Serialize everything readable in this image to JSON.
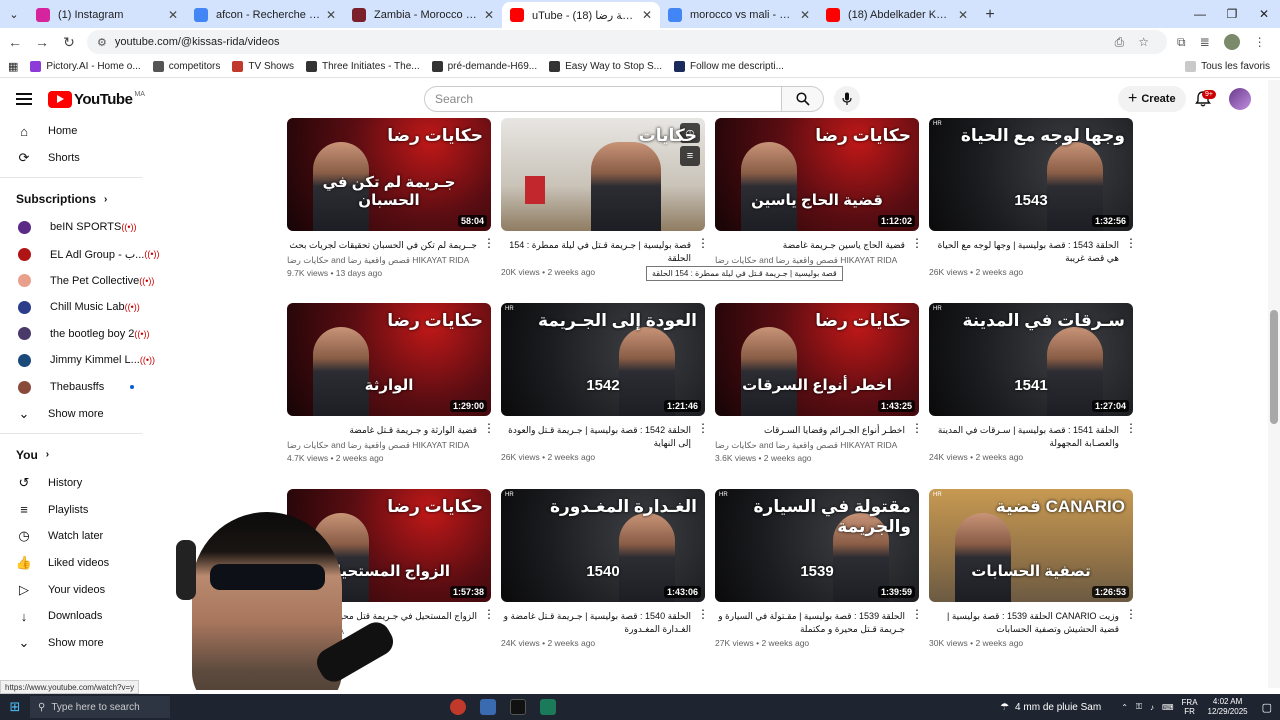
{
  "browser": {
    "tabs": [
      {
        "title": "(1) Instagram",
        "color": "#d6249f",
        "active": false
      },
      {
        "title": "afcon - Recherche Google",
        "color": "#4285f4",
        "active": false
      },
      {
        "title": "Zambia - Morocco Betting - 29",
        "color": "#7a1f2b",
        "active": false
      },
      {
        "title": "uTube - (18) قصص واقعية رضا",
        "color": "#ff0000",
        "active": true
      },
      {
        "title": "morocco vs mali - Recherche G",
        "color": "#4285f4",
        "active": false
      },
      {
        "title": "(18) Abdelkader Kharraz - YouT",
        "color": "#ff0000",
        "active": false
      }
    ],
    "url": "youtube.com/@kissas-rida/videos",
    "bookmarks": [
      {
        "label": "Pictory.AI - Home o...",
        "color": "#8c3bd9"
      },
      {
        "label": "competitors",
        "color": "#555555"
      },
      {
        "label": "TV Shows",
        "color": "#c0392b"
      },
      {
        "label": "Three Initiates - The...",
        "color": "#333333"
      },
      {
        "label": "pré-demande-H69...",
        "color": "#333333"
      },
      {
        "label": "Easy Way to Stop S...",
        "color": "#333333"
      },
      {
        "label": "Follow me descripti...",
        "color": "#1a2a5a"
      }
    ],
    "all_bookmarks": "Tous les favoris",
    "status_url": "https://www.youtube.com/watch?v=y"
  },
  "yt": {
    "logo_text": "YouTube",
    "country": "MA",
    "search_placeholder": "Search",
    "create_label": "Create",
    "notif_badge": "9+",
    "tooltip": "قصة بوليسية | جـريمة قـتل في ليلة ممطرة : 154 الحلقة"
  },
  "sidebar": {
    "main": [
      {
        "label": "Home",
        "icon": "home-icon",
        "glyph": "⌂"
      },
      {
        "label": "Shorts",
        "icon": "shorts-icon",
        "glyph": "⟳"
      }
    ],
    "subs_title": "Subscriptions",
    "subs": [
      {
        "label": "beIN SPORTS",
        "color": "#5b2a86",
        "live": true
      },
      {
        "label": "EL Adl Group - ب...",
        "color": "#b01515",
        "live": true
      },
      {
        "label": "The Pet Collective",
        "color": "#e8a08a",
        "live": true
      },
      {
        "label": "Chill Music Lab",
        "color": "#2a3c8a",
        "live": true
      },
      {
        "label": "the bootleg boy 2",
        "color": "#4a3a6a",
        "live": true
      },
      {
        "label": "Jimmy Kimmel L...",
        "color": "#1a4a7a",
        "live": true
      },
      {
        "label": "Thebausffs",
        "color": "#8a4a3a",
        "live": false
      }
    ],
    "show_more": "Show more",
    "you_title": "You",
    "you": [
      {
        "label": "History",
        "icon": "history-icon",
        "glyph": "↺"
      },
      {
        "label": "Playlists",
        "icon": "playlists-icon",
        "glyph": "≡"
      },
      {
        "label": "Watch later",
        "icon": "watch-later-icon",
        "glyph": "◷"
      },
      {
        "label": "Liked videos",
        "icon": "like-icon",
        "glyph": "👍"
      },
      {
        "label": "Your videos",
        "icon": "your-videos-icon",
        "glyph": "▷"
      },
      {
        "label": "Downloads",
        "icon": "downloads-icon",
        "glyph": "↓"
      }
    ],
    "show_more2": "Show more"
  },
  "videos": [
    {
      "title": "جــريمة لم تكن في الحسبان تحقيقات لجريات بحث",
      "thumb_top": "حكايات رضا",
      "thumb_bottom": "جـريمة لم تكن في الحسبان",
      "channel": "حكايات رضا and قصص واقعية رضا HIKAYAT RIDA",
      "stats": "9.7K views • 13 days ago",
      "duration": "58:04",
      "bg": "A"
    },
    {
      "title": "قصة بوليسية | جـريمة قـتل في ليلة ممطرة : 154 الحلقة",
      "thumb_top": "حكايات",
      "thumb_bottom": "",
      "channel": "",
      "stats": "20K views • 2 weeks ago",
      "duration": "",
      "bg": "C"
    },
    {
      "title": "قضية الحاج ياسين جـريمة غامضة",
      "thumb_top": "حكايات رضا",
      "thumb_bottom": "قضية الحاج ياسين",
      "channel": "حكايات رضا and قصص واقعية رضا HIKAYAT RIDA",
      "stats": "",
      "duration": "1:12:02",
      "bg": "A"
    },
    {
      "title": "الحلقة 1543 : قصة بوليسية | وجها لوجه مع الحياة هي قصة غريبة",
      "thumb_top": "وجها لوجه مع الحياة",
      "thumb_bottom": "1543",
      "channel": "",
      "stats": "26K views • 2 weeks ago",
      "duration": "1:32:56",
      "bg": "B"
    },
    {
      "title": "قضية الوارثة و جـريمة قـتل غامضة",
      "thumb_top": "حكايات رضا",
      "thumb_bottom": "الوارثة",
      "channel": "حكايات رضا and قصص واقعية رضا HIKAYAT RIDA",
      "stats": "4.7K views • 2 weeks ago",
      "duration": "1:29:00",
      "bg": "A"
    },
    {
      "title": "الحلقة 1542 : قصة بوليسية | جـريمة قـتل والعودة إلى النهاية",
      "thumb_top": "العودة إلى الجـريمة",
      "thumb_bottom": "1542",
      "channel": "",
      "stats": "26K views • 2 weeks ago",
      "duration": "1:21:46",
      "bg": "B"
    },
    {
      "title": "اخطـر أنواع الجـرائم وقضايا السـرقات",
      "thumb_top": "حكايات رضا",
      "thumb_bottom": "اخطر أنواع السرقات",
      "channel": "حكايات رضا and قصص واقعية رضا HIKAYAT RIDA",
      "stats": "3.6K views • 2 weeks ago",
      "duration": "1:43:25",
      "bg": "A"
    },
    {
      "title": "الحلقة 1541 : قصة بوليسية | سـرقات في المدينة والعصـابة المجهولة",
      "thumb_top": "سـرقات في المدينة",
      "thumb_bottom": "1541",
      "channel": "",
      "stats": "24K views • 2 weeks ago",
      "duration": "1:27:04",
      "bg": "B"
    },
    {
      "title": "الزواج المستحيل في جـريمة قتل محيرة",
      "thumb_top": "حكايات رضا",
      "thumb_bottom": "الزواج المستحيل",
      "channel": "HIKAYAT RIDA",
      "stats": "",
      "duration": "1:57:38",
      "bg": "A"
    },
    {
      "title": "الحلقة 1540 : قصة بوليسية | جـريمة قـتل غامضة و الغـدارة المغـدورة",
      "thumb_top": "الغـدارة المغـدورة",
      "thumb_bottom": "1540",
      "channel": "",
      "stats": "24K views • 2 weeks ago",
      "duration": "1:43:06",
      "bg": "B"
    },
    {
      "title": "الحلقة 1539 : قصة بوليسية | مقـتولة في السيارة و جـريمة قـتل محيرة و مكتملة",
      "thumb_top": "مقتولة في السيارة والجريمة",
      "thumb_bottom": "1539",
      "channel": "",
      "stats": "27K views • 2 weeks ago",
      "duration": "1:39:59",
      "bg": "B"
    },
    {
      "title": "وزيت CANARIO الحلقة 1539 : قصة بوليسية | قضية الحشيش وتصفية الحسابات",
      "thumb_top": "CANARIO قضية",
      "thumb_bottom": "تصفية الحسابات",
      "channel": "",
      "stats": "30K views • 2 weeks ago",
      "duration": "1:26:53",
      "bg": "D"
    }
  ],
  "taskbar": {
    "search": "Type here to search",
    "weather": "4 mm de pluie Sam",
    "lang": "FRA",
    "lang2": "FR",
    "time": "4:02 AM",
    "date": "12/29/2025"
  }
}
